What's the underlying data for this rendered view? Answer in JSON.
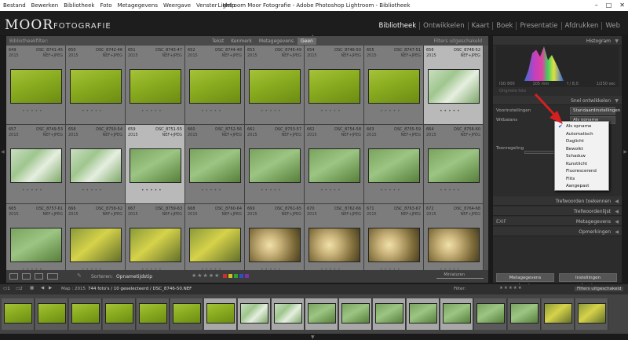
{
  "window": {
    "title": "Lightroom Moor Fotografie - Adobe Photoshop Lightroom - Bibliotheek",
    "menu": [
      "Bestand",
      "Bewerken",
      "Bibliotheek",
      "Foto",
      "Metagegevens",
      "Weergave",
      "Venster",
      "Help"
    ]
  },
  "identity": {
    "logo": "MOOR",
    "logo_sub": "FOTOGRAFIE"
  },
  "modules": [
    "Bibliotheek",
    "Ontwikkelen",
    "Kaart",
    "Boek",
    "Presentatie",
    "Afdrukken",
    "Web"
  ],
  "filterbar": {
    "title": "Bibliotheekfilter:",
    "tabs": [
      "Tekst",
      "Kenmerk",
      "Metagegevens",
      "Geen"
    ],
    "preset": "Filters uitgeschakeld"
  },
  "grid": {
    "rows": [
      [
        {
          "num": "649",
          "file": "DSC_8741-45",
          "type": "NEF+JPEG",
          "year": "2015",
          "thumb": "green1",
          "sel": false
        },
        {
          "num": "650",
          "file": "DSC_8742-46",
          "type": "NEF+JPEG",
          "year": "2015",
          "thumb": "green1",
          "sel": false
        },
        {
          "num": "651",
          "file": "DSC_8743-47",
          "type": "NEF+JPEG",
          "year": "2015",
          "thumb": "green1",
          "sel": false
        },
        {
          "num": "652",
          "file": "DSC_8744-48",
          "type": "NEF+JPEG",
          "year": "2015",
          "thumb": "green1",
          "sel": false
        },
        {
          "num": "653",
          "file": "DSC_8745-49",
          "type": "NEF+JPEG",
          "year": "2015",
          "thumb": "green1",
          "sel": false
        },
        {
          "num": "654",
          "file": "DSC_8746-50",
          "type": "NEF+JPEG",
          "year": "2015",
          "thumb": "green1",
          "sel": false
        },
        {
          "num": "655",
          "file": "DSC_8747-51",
          "type": "NEF+JPEG",
          "year": "2015",
          "thumb": "green1",
          "sel": false
        },
        {
          "num": "656",
          "file": "DSC_8748-52",
          "type": "NEF+JPEG",
          "year": "2015",
          "thumb": "green2",
          "sel": true
        }
      ],
      [
        {
          "num": "657",
          "file": "DSC_8749-53",
          "type": "NEF+JPEG",
          "year": "2015",
          "thumb": "green2",
          "sel": false
        },
        {
          "num": "658",
          "file": "DSC_8750-54",
          "type": "NEF+JPEG",
          "year": "2015",
          "thumb": "green2",
          "sel": false
        },
        {
          "num": "659",
          "file": "DSC_8751-55",
          "type": "NEF+JPEG",
          "year": "2015",
          "thumb": "green3",
          "sel": true
        },
        {
          "num": "660",
          "file": "DSC_8752-56",
          "type": "NEF+JPEG",
          "year": "2015",
          "thumb": "green3",
          "sel": false
        },
        {
          "num": "661",
          "file": "DSC_8753-57",
          "type": "NEF+JPEG",
          "year": "2015",
          "thumb": "green3",
          "sel": false
        },
        {
          "num": "662",
          "file": "DSC_8754-58",
          "type": "NEF+JPEG",
          "year": "2015",
          "thumb": "green3",
          "sel": false
        },
        {
          "num": "663",
          "file": "DSC_8755-59",
          "type": "NEF+JPEG",
          "year": "2015",
          "thumb": "green3",
          "sel": false
        },
        {
          "num": "664",
          "file": "DSC_8756-60",
          "type": "NEF+JPEG",
          "year": "2015",
          "thumb": "green3",
          "sel": false
        }
      ],
      [
        {
          "num": "665",
          "file": "DSC_8757-61",
          "type": "NEF+JPEG",
          "year": "2015",
          "thumb": "green3",
          "sel": false
        },
        {
          "num": "666",
          "file": "DSC_8758-62",
          "type": "NEF+JPEG",
          "year": "2015",
          "thumb": "yellow",
          "sel": false
        },
        {
          "num": "667",
          "file": "DSC_8759-63",
          "type": "NEF+JPEG",
          "year": "2015",
          "thumb": "yellow",
          "sel": false
        },
        {
          "num": "668",
          "file": "DSC_8760-64",
          "type": "NEF+JPEG",
          "year": "2015",
          "thumb": "yellow",
          "sel": false
        },
        {
          "num": "669",
          "file": "DSC_8761-65",
          "type": "NEF+JPEG",
          "year": "2015",
          "thumb": "flower",
          "sel": false
        },
        {
          "num": "670",
          "file": "DSC_8762-66",
          "type": "NEF+JPEG",
          "year": "2015",
          "thumb": "flower",
          "sel": false
        },
        {
          "num": "671",
          "file": "DSC_8763-67",
          "type": "NEF+JPEG",
          "year": "2015",
          "thumb": "flower",
          "sel": false
        },
        {
          "num": "672",
          "file": "DSC_8764-68",
          "type": "NEF+JPEG",
          "year": "2015",
          "thumb": "flower",
          "sel": false
        }
      ]
    ]
  },
  "toolbar": {
    "sort_label": "Sorteren:",
    "sort_value": "Opnametijdstip",
    "thumb_label": "Miniaturen"
  },
  "histogram": {
    "title": "Histogram",
    "iso": "ISO 800",
    "focal": "105 mm",
    "aperture": "f / 8,0",
    "shutter": "1/250 sec",
    "original": "Originele foto"
  },
  "quickdevelop": {
    "title": "Snel ontwikkelen",
    "preset_label": "Voorinstellingen",
    "preset_value": "Standaardinstellingen",
    "wb_label": "Witbalans",
    "wb_value": "Als opname",
    "tone_label": "Toonregeling"
  },
  "dropdown": [
    "Als opname",
    "Automatisch",
    "Daglicht",
    "Bewolkt",
    "Schaduw",
    "Kunstlicht",
    "Fluorescerend",
    "Flits",
    "Aangepast"
  ],
  "panels": {
    "keywording": "Trefwoorden toekennen",
    "keywordlist": "Trefwoordenlijst",
    "metadata": "Metagegevens",
    "metadata_preset": "EXIF",
    "comments": "Opmerkingen"
  },
  "buttons": {
    "sync_meta": "Metagegevens synchroniseren",
    "sync_settings": "Instellingen synchroniseren"
  },
  "filmstrip": {
    "source": "Map : 2015",
    "count": "744 foto's / 10 geselecteerd / DSC_8746-50.NEF",
    "filter_label": "Filter:",
    "filter_value": "Filters uitgeschakeld"
  },
  "colors": {
    "accent_arrow": "#d42020",
    "label_red": "#c83030",
    "label_yellow": "#d0c020",
    "label_green": "#30a030",
    "label_blue": "#3050c0",
    "label_purple": "#8030a0"
  }
}
